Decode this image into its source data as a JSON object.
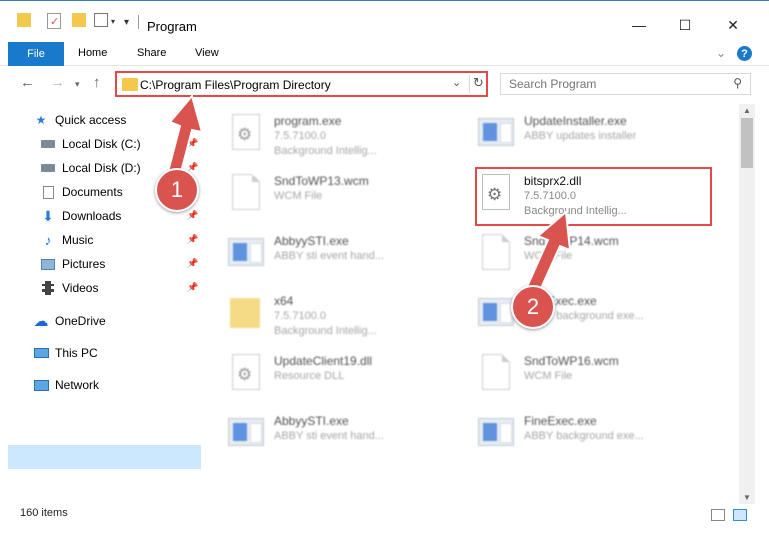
{
  "window": {
    "title": "Program",
    "minimize": "—",
    "maximize": "☐",
    "close": "✕"
  },
  "ribbon": {
    "file": "File",
    "home": "Home",
    "share": "Share",
    "view": "View",
    "help": "?"
  },
  "address": {
    "path": "C:\\Program Files\\Program Directory"
  },
  "search": {
    "placeholder": "Search Program"
  },
  "nav": {
    "quick_access": "Quick access",
    "local_c": "Local Disk (C:)",
    "local_d": "Local Disk (D:)",
    "documents": "Documents",
    "downloads": "Downloads",
    "music": "Music",
    "pictures": "Pictures",
    "videos": "Videos",
    "onedrive": "OneDrive",
    "this_pc": "This PC",
    "network": "Network"
  },
  "files": {
    "f1": {
      "name": "program.exe",
      "sub": "7.5.7100.0",
      "sub2": "Background Intellig..."
    },
    "f2": {
      "name": "UpdateInstaller.exe",
      "sub": "ABBY updates installer"
    },
    "f3": {
      "name": "SndToWP13.wcm",
      "sub": "WCM File"
    },
    "f4": {
      "name": "bitsprx2.dll",
      "sub": "7.5.7100.0",
      "sub2": "Background Intellig..."
    },
    "f5": {
      "name": "AbbyySTI.exe",
      "sub": "ABBY sti event hand..."
    },
    "f6": {
      "name": "SndToWP14.wcm",
      "sub": "WCM File"
    },
    "f7": {
      "name": "x64",
      "sub": "7.5.7100.0",
      "sub2": "Background Intellig..."
    },
    "f8": {
      "name": "FineExec.exe",
      "sub": "ABBY background exe..."
    },
    "f9": {
      "name": "UpdateClient19.dll",
      "sub": "Resource DLL"
    },
    "f10": {
      "name": "SndToWP16.wcm",
      "sub": "WCM File"
    },
    "f11": {
      "name": "AbbyySTI.exe",
      "sub": "ABBY sti event hand..."
    },
    "f12": {
      "name": "FineExec.exe",
      "sub": "ABBY background exe..."
    }
  },
  "status": {
    "count": "160 items"
  },
  "annotations": {
    "step1": "1",
    "step2": "2"
  }
}
